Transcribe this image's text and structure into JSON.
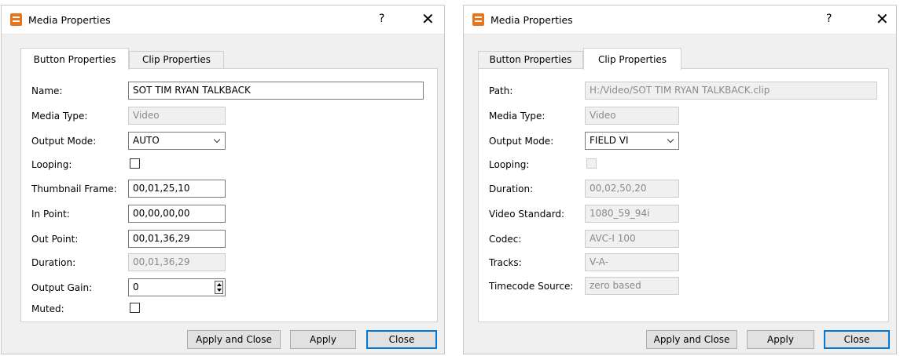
{
  "left_dialog": {
    "title": "Media Properties",
    "help": "?",
    "close": "✕",
    "tabs": [
      "Button Properties",
      "Clip Properties"
    ],
    "fields": {
      "name": {
        "label": "Name:",
        "value": "SOT TIM RYAN TALKBACK"
      },
      "media_type": {
        "label": "Media Type:",
        "value": "Video"
      },
      "output_mode": {
        "label": "Output Mode:",
        "value": "AUTO"
      },
      "looping": {
        "label": "Looping:"
      },
      "thumbnail_frame": {
        "label": "Thumbnail Frame:",
        "value": "00,01,25,10"
      },
      "in_point": {
        "label": "In Point:",
        "value": "00,00,00,00"
      },
      "out_point": {
        "label": "Out Point:",
        "value": "00,01,36,29"
      },
      "duration": {
        "label": "Duration:",
        "value": "00,01,36,29"
      },
      "output_gain": {
        "label": "Output Gain:",
        "value": "0"
      },
      "muted": {
        "label": "Muted:"
      }
    },
    "buttons": {
      "apply_close": "Apply and Close",
      "apply": "Apply",
      "close": "Close"
    }
  },
  "right_dialog": {
    "title": "Media Properties",
    "help": "?",
    "close": "✕",
    "tabs": [
      "Button Properties",
      "Clip Properties"
    ],
    "fields": {
      "path": {
        "label": "Path:",
        "value": "H:/Video/SOT TIM RYAN TALKBACK.clip"
      },
      "media_type": {
        "label": "Media Type:",
        "value": "Video"
      },
      "output_mode": {
        "label": "Output Mode:",
        "value": "FIELD VI"
      },
      "looping": {
        "label": "Looping:"
      },
      "duration": {
        "label": "Duration:",
        "value": "00,02,50,20"
      },
      "video_standard": {
        "label": "Video Standard:",
        "value": "1080_59_94i"
      },
      "codec": {
        "label": "Codec:",
        "value": "AVC-I 100"
      },
      "tracks": {
        "label": "Tracks:",
        "value": "V-A-"
      },
      "timecode_source": {
        "label": "Timecode Source:",
        "value": "zero based"
      }
    },
    "buttons": {
      "apply_close": "Apply and Close",
      "apply": "Apply",
      "close": "Close"
    }
  },
  "colors": {
    "accent": "#0078d7",
    "app_icon": "#e8751a"
  }
}
